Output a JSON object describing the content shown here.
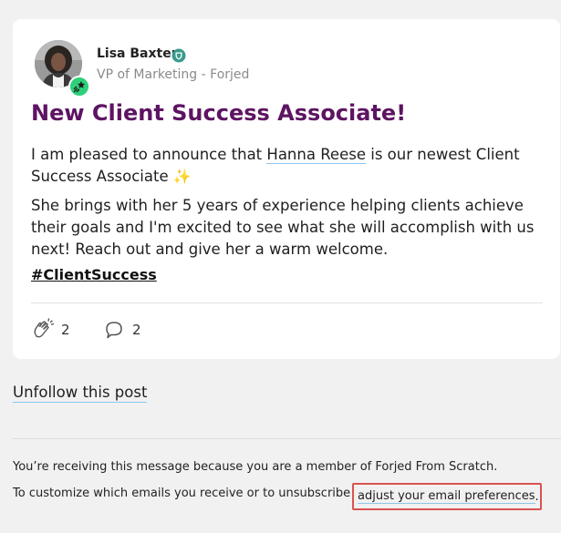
{
  "post": {
    "author": {
      "name": "Lisa Baxter",
      "title": "VP of Marketing - Forjed",
      "verified_icon": "shield-check-icon",
      "badge_icon": "shooting-star-icon"
    },
    "title": "New Client Success Associate!",
    "paragraph1_before": "I am pleased to announce that ",
    "mention": "Hanna Reese",
    "paragraph1_after": " is our newest Client Success Associate ",
    "sparkles": "✨",
    "paragraph2": "She brings with her 5 years of experience helping clients achieve their goals and I'm excited to see what she will accomplish with us next! Reach out and give her a warm welcome.",
    "hashtag": "#ClientSuccess",
    "reactions": {
      "clap_count": "2",
      "comment_count": "2"
    }
  },
  "unfollow_label": "Unfollow this post",
  "footer": {
    "membership_text": "You’re receiving this message because you are a member of Forjed From Scratch.",
    "customize_text": "To customize which emails you receive or to unsubscribe",
    "preferences_link": "adjust your email preferences",
    "period": "."
  },
  "colors": {
    "title_purple": "#5d1462",
    "link_underline": "#8bc6ee",
    "badge_green": "#2fd07b",
    "highlight_red": "#d9534f",
    "verified_teal": "#3a9a8c"
  }
}
